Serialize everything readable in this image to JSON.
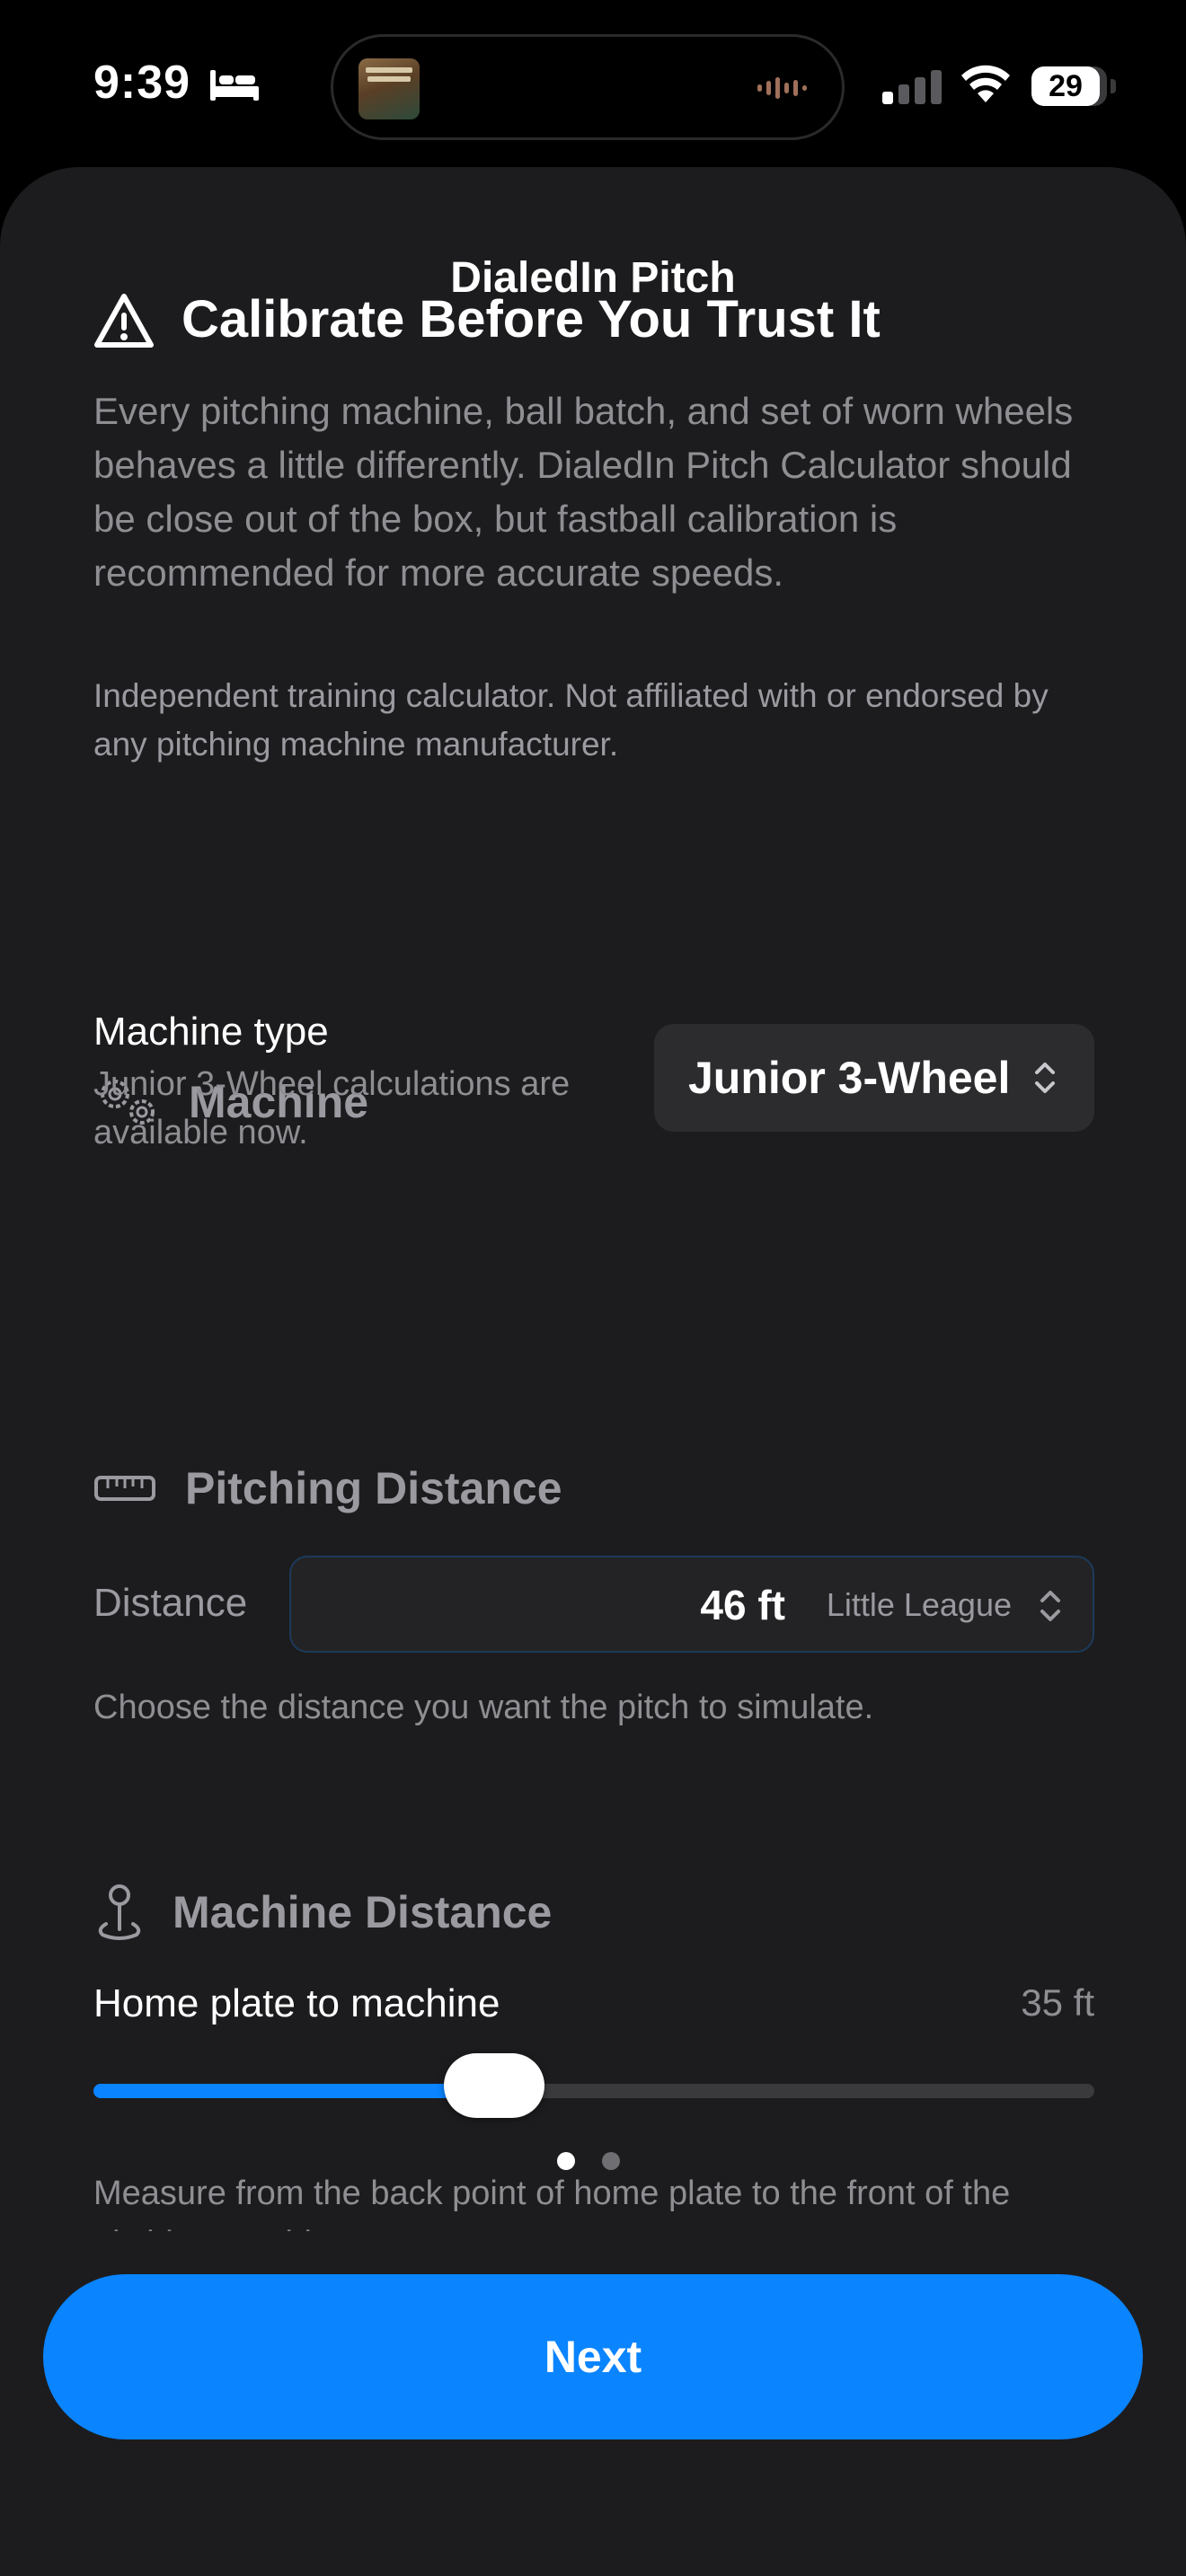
{
  "status_bar": {
    "time": "9:39",
    "battery": "29",
    "icons": [
      "bed-icon",
      "album-art-icon",
      "audio-wave-icon",
      "cellular-signal-icon",
      "wifi-icon",
      "battery-icon"
    ]
  },
  "sheet": {
    "title": "DialedIn Pitch"
  },
  "calibrate": {
    "icon": "warning-triangle-icon",
    "heading": "Calibrate Before You Trust It",
    "body": "Every pitching machine, ball batch, and set of worn wheels behaves a little differently. DialedIn Pitch Calculator should be close out of the box, but fastball calibration is recommended for more accurate speeds.",
    "note": "Independent training calculator. Not affiliated with or endorsed by any pitching machine manufacturer."
  },
  "machine": {
    "icon": "gears-icon",
    "header": "Machine",
    "type_label": "Machine type",
    "type_description": "Junior 3-Wheel calculations are available now.",
    "selected": "Junior 3-Wheel"
  },
  "pitching_distance": {
    "icon": "ruler-icon",
    "header": "Pitching Distance",
    "label": "Distance",
    "value": "46 ft",
    "level": "Little League",
    "help": "Choose the distance you want the pitch to simulate."
  },
  "machine_distance": {
    "icon": "pin-icon",
    "header": "Machine Distance",
    "label": "Home plate to machine",
    "value_text": "35 ft",
    "slider_fraction": 0.4,
    "help": "Measure from the back point of home plate to the front of the pitching machine."
  },
  "pagination": {
    "total": 2,
    "current": 1
  },
  "next_button": {
    "label": "Next"
  },
  "colors": {
    "accent": "#0a84ff",
    "sheet_background": "#1c1c1e",
    "secondary_text": "#8e8e93"
  }
}
